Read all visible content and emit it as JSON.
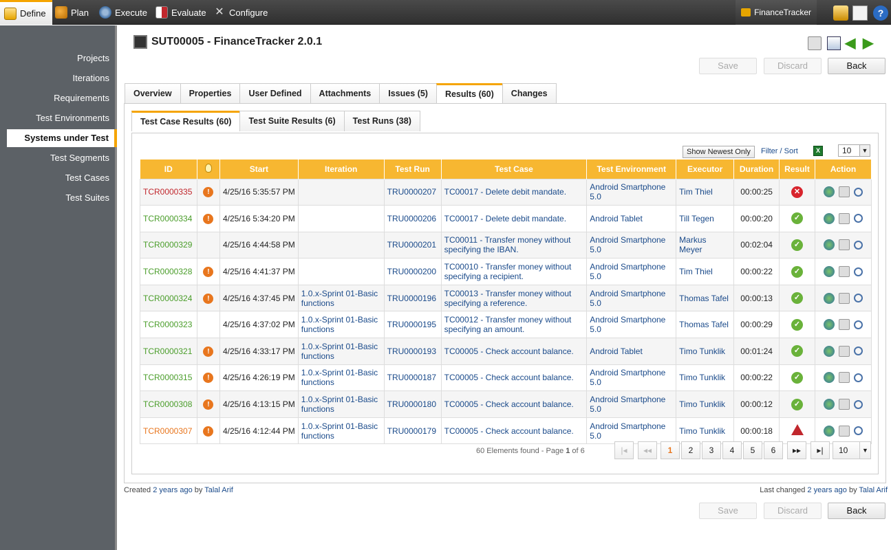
{
  "topbar": {
    "nav": [
      {
        "label": "Define",
        "icon": "define-icon"
      },
      {
        "label": "Plan",
        "icon": "plan-icon"
      },
      {
        "label": "Execute",
        "icon": "execute-icon"
      },
      {
        "label": "Evaluate",
        "icon": "evaluate-icon"
      },
      {
        "label": "Configure",
        "icon": "configure-icon"
      }
    ],
    "project_label": "FinanceTracker"
  },
  "sidebar": {
    "items": [
      "Projects",
      "Iterations",
      "Requirements",
      "Test Environments",
      "Systems under Test",
      "Test Segments",
      "Test Cases",
      "Test Suites"
    ],
    "active": "Systems under Test"
  },
  "header": {
    "title": "SUT00005 - FinanceTracker 2.0.1"
  },
  "buttons": {
    "save": "Save",
    "discard": "Discard",
    "back": "Back"
  },
  "tabs": [
    "Overview",
    "Properties",
    "User Defined",
    "Attachments",
    "Issues (5)",
    "Results (60)",
    "Changes"
  ],
  "subtabs": [
    "Test Case Results (60)",
    "Test Suite Results (6)",
    "Test Runs (38)"
  ],
  "toolbar": {
    "show_newest": "Show Newest Only",
    "filter_sort": "Filter / Sort",
    "page_size": "10"
  },
  "table": {
    "columns": [
      "ID",
      "",
      "Start",
      "Iteration",
      "Test Run",
      "Test Case",
      "Test Environment",
      "Executor",
      "Duration",
      "Result",
      "Action"
    ],
    "rows": [
      {
        "id": "TCR0000335",
        "id_color": "red",
        "warn": true,
        "start": "4/25/16 5:35:57 PM",
        "iteration": "",
        "run": "TRU0000207",
        "case": "TC00017 - Delete debit mandate.",
        "env": "Android Smartphone 5.0",
        "executor": "Tim Thiel",
        "duration": "00:00:25",
        "result": "fail"
      },
      {
        "id": "TCR0000334",
        "id_color": "green",
        "warn": true,
        "start": "4/25/16 5:34:20 PM",
        "iteration": "",
        "run": "TRU0000206",
        "case": "TC00017 - Delete debit mandate.",
        "env": "Android Tablet",
        "executor": "Till Tegen",
        "duration": "00:00:20",
        "result": "pass"
      },
      {
        "id": "TCR0000329",
        "id_color": "green",
        "warn": false,
        "start": "4/25/16 4:44:58 PM",
        "iteration": "",
        "run": "TRU0000201",
        "case": "TC00011 - Transfer money without specifying the IBAN.",
        "env": "Android Smartphone 5.0",
        "executor": "Markus Meyer",
        "duration": "00:02:04",
        "result": "pass"
      },
      {
        "id": "TCR0000328",
        "id_color": "green",
        "warn": true,
        "start": "4/25/16 4:41:37 PM",
        "iteration": "",
        "run": "TRU0000200",
        "case": "TC00010 - Transfer money without specifying a recipient.",
        "env": "Android Smartphone 5.0",
        "executor": "Tim Thiel",
        "duration": "00:00:22",
        "result": "pass"
      },
      {
        "id": "TCR0000324",
        "id_color": "green",
        "warn": true,
        "start": "4/25/16 4:37:45 PM",
        "iteration": "1.0.x-Sprint 01-Basic functions",
        "run": "TRU0000196",
        "case": "TC00013 - Transfer money without specifying a reference.",
        "env": "Android Smartphone 5.0",
        "executor": "Thomas Tafel",
        "duration": "00:00:13",
        "result": "pass"
      },
      {
        "id": "TCR0000323",
        "id_color": "green",
        "warn": false,
        "start": "4/25/16 4:37:02 PM",
        "iteration": "1.0.x-Sprint 01-Basic functions",
        "run": "TRU0000195",
        "case": "TC00012 - Transfer money without specifying an amount.",
        "env": "Android Smartphone 5.0",
        "executor": "Thomas Tafel",
        "duration": "00:00:29",
        "result": "pass"
      },
      {
        "id": "TCR0000321",
        "id_color": "green",
        "warn": true,
        "start": "4/25/16 4:33:17 PM",
        "iteration": "1.0.x-Sprint 01-Basic functions",
        "run": "TRU0000193",
        "case": "TC00005 - Check account balance.",
        "env": "Android Tablet",
        "executor": "Timo Tunklik",
        "duration": "00:01:24",
        "result": "pass"
      },
      {
        "id": "TCR0000315",
        "id_color": "green",
        "warn": true,
        "start": "4/25/16 4:26:19 PM",
        "iteration": "1.0.x-Sprint 01-Basic functions",
        "run": "TRU0000187",
        "case": "TC00005 - Check account balance.",
        "env": "Android Smartphone 5.0",
        "executor": "Timo Tunklik",
        "duration": "00:00:22",
        "result": "pass"
      },
      {
        "id": "TCR0000308",
        "id_color": "green",
        "warn": true,
        "start": "4/25/16 4:13:15 PM",
        "iteration": "1.0.x-Sprint 01-Basic functions",
        "run": "TRU0000180",
        "case": "TC00005 - Check account balance.",
        "env": "Android Smartphone 5.0",
        "executor": "Timo Tunklik",
        "duration": "00:00:12",
        "result": "pass"
      },
      {
        "id": "TCR0000307",
        "id_color": "orange",
        "warn": true,
        "start": "4/25/16 4:12:44 PM",
        "iteration": "1.0.x-Sprint 01-Basic functions",
        "run": "TRU0000179",
        "case": "TC00005 - Check account balance.",
        "env": "Android Smartphone 5.0",
        "executor": "Timo Tunklik",
        "duration": "00:00:18",
        "result": "error"
      }
    ]
  },
  "pager": {
    "summary_prefix": "60 Elements found - Page ",
    "current": "1",
    "summary_suffix": " of 6",
    "pages": [
      "1",
      "2",
      "3",
      "4",
      "5",
      "6"
    ],
    "page_size": "10"
  },
  "footer": {
    "created_prefix": "Created ",
    "created_when": "2 years ago",
    "by": " by ",
    "created_by": "Talal Arif",
    "changed_prefix": "Last changed ",
    "changed_when": "2 years ago",
    "changed_by": "Talal Arif"
  },
  "colors": {
    "accent": "#f5a400",
    "header_orange": "#f7b731",
    "link": "#1a4a8a",
    "pass": "#6ab23a",
    "fail": "#d8242d"
  }
}
